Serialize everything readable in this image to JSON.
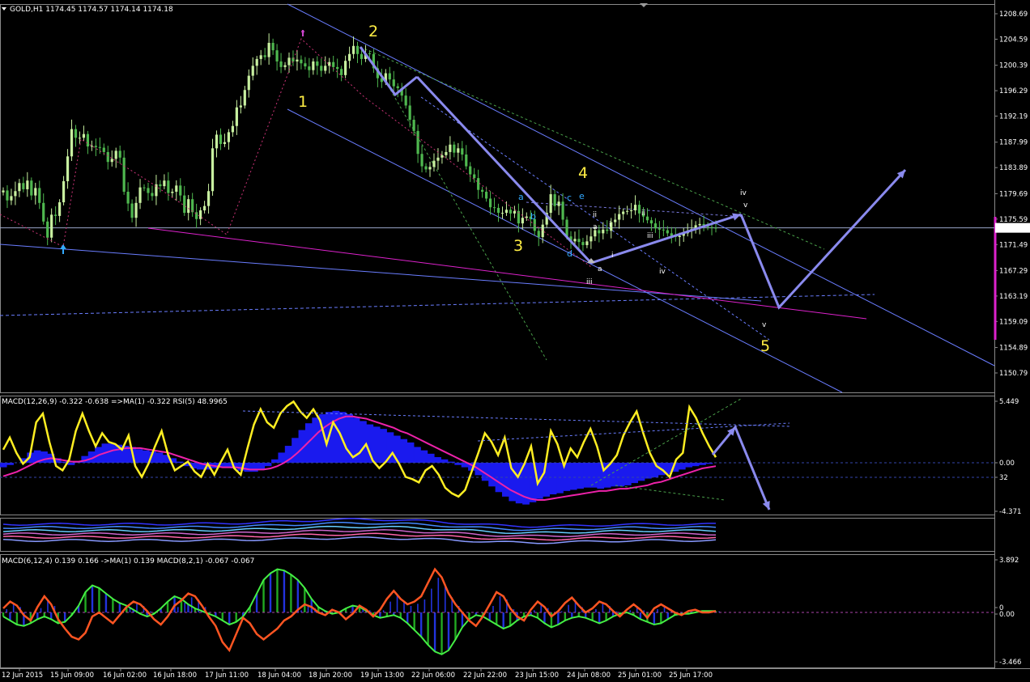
{
  "chart_data": {
    "type": "candlestick",
    "main": {
      "header": "GOLD,H1  1174.45 1174.57 1174.14 1174.18",
      "y_ticks": [
        "1208.69",
        "1204.59",
        "1200.39",
        "1196.29",
        "1192.19",
        "1187.99",
        "1183.89",
        "1179.69",
        "1175.59",
        "1171.49",
        "1167.29",
        "1163.19",
        "1159.09",
        "1154.89",
        "1150.79"
      ],
      "ylim": [
        1150.79,
        1208.69
      ],
      "current_price": "1174.18",
      "colors": {
        "bull": "#c8f0a0",
        "bear": "#4fb84f",
        "channel": "#6a7dff",
        "arrow": "#8a8aee",
        "support": "#dd22cc",
        "price_line": "#9aa6c8"
      },
      "closes": [
        1180.2,
        1178.6,
        1179.3,
        1180.1,
        1181.4,
        1180.4,
        1181.8,
        1179.4,
        1180.6,
        1178.2,
        1175.2,
        1172.6,
        1176.3,
        1176.1,
        1178.3,
        1181.7,
        1185.7,
        1190.1,
        1188.7,
        1188.7,
        1189.3,
        1187.3,
        1187.4,
        1187.2,
        1187.1,
        1186.4,
        1184.8,
        1185.3,
        1186.6,
        1185.5,
        1180.0,
        1178.1,
        1175.8,
        1178.2,
        1180.7,
        1180.6,
        1179.8,
        1179.3,
        1181.2,
        1180.9,
        1181.8,
        1179.8,
        1180.0,
        1181.0,
        1179.4,
        1176.6,
        1178.8,
        1176.7,
        1175.6,
        1177.0,
        1177.7,
        1180.1,
        1187.0,
        1189.2,
        1187.7,
        1188.0,
        1189.6,
        1190.6,
        1193.6,
        1193.9,
        1196.4,
        1198.7,
        1200.3,
        1201.4,
        1202.0,
        1201.7,
        1204.0,
        1202.8,
        1201.0,
        1200.1,
        1200.4,
        1201.6,
        1201.0,
        1201.3,
        1200.7,
        1200.2,
        1199.6,
        1201.0,
        1200.3,
        1199.5,
        1200.3,
        1200.9,
        1200.1,
        1199.8,
        1198.8,
        1201.1,
        1202.2,
        1203.5,
        1202.2,
        1201.4,
        1202.3,
        1202.2,
        1199.9,
        1198.3,
        1197.7,
        1199.1,
        1198.1,
        1197.0,
        1196.7,
        1195.5,
        1193.9,
        1191.6,
        1189.8,
        1186.1,
        1184.1,
        1183.6,
        1184.0,
        1185.0,
        1185.5,
        1185.9,
        1186.4,
        1187.6,
        1186.3,
        1187.0,
        1186.0,
        1184.1,
        1182.8,
        1182.2,
        1180.3,
        1180.0,
        1178.9,
        1177.5,
        1177.4,
        1176.6,
        1176.6,
        1177.1,
        1176.5,
        1176.9,
        1174.9,
        1175.8,
        1176.0,
        1175.6,
        1173.7,
        1172.7,
        1174.7,
        1176.6,
        1179.6,
        1177.7,
        1178.4,
        1175.5,
        1172.8,
        1172.0,
        1172.4,
        1171.9,
        1171.4,
        1172.0,
        1172.8,
        1173.8,
        1173.3,
        1173.9,
        1173.7,
        1175.1,
        1175.5,
        1176.4,
        1176.8,
        1176.9,
        1177.0,
        1177.9,
        1176.5,
        1176.0,
        1175.4,
        1174.9,
        1174.1,
        1173.9,
        1173.8,
        1173.3,
        1172.9,
        1172.7,
        1172.9,
        1173.3,
        1173.7,
        1174.0,
        1174.6,
        1174.8,
        1174.6,
        1174.3,
        1174.2,
        1174.18
      ],
      "wave_labels": [
        {
          "t": "1",
          "c": "#ffee44",
          "cls": "wave"
        },
        {
          "t": "2",
          "c": "#ffee44",
          "cls": "wave"
        },
        {
          "t": "3",
          "c": "#ffee44",
          "cls": "wave"
        },
        {
          "t": "4",
          "c": "#ffee44",
          "cls": "wave"
        },
        {
          "t": "5",
          "c": "#ffee44",
          "cls": "wave"
        },
        {
          "t": "a",
          "c": "#33aaff",
          "cls": "sub"
        },
        {
          "t": "b",
          "c": "#33aaff",
          "cls": "sub"
        },
        {
          "t": "c",
          "c": "#33aaff",
          "cls": "sub"
        },
        {
          "t": "d",
          "c": "#33aaff",
          "cls": "sub"
        },
        {
          "t": "e",
          "c": "#33aaff",
          "cls": "sub"
        },
        {
          "t": "iii",
          "c": "#cc44cc",
          "cls": "small"
        },
        {
          "t": "iv",
          "c": "#cc44cc",
          "cls": "small"
        },
        {
          "t": "v",
          "c": "#cc44cc",
          "cls": "small"
        },
        {
          "t": "ii",
          "c": "#cc4444",
          "cls": "small"
        },
        {
          "t": "a",
          "c": "#cc4444",
          "cls": "small"
        },
        {
          "t": "i",
          "c": "#cc4444",
          "cls": "small"
        },
        {
          "t": "a",
          "c": "#cc4444",
          "cls": "small"
        },
        {
          "t": "ii",
          "c": "#cc8844",
          "cls": "small"
        },
        {
          "t": "iii",
          "c": "#cc8844",
          "cls": "small"
        },
        {
          "t": "iv",
          "c": "#cc8844",
          "cls": "small"
        },
        {
          "t": "i",
          "c": "#cc8844",
          "cls": "small"
        },
        {
          "t": "v",
          "c": "#cc8844",
          "cls": "small"
        }
      ]
    },
    "panel1": {
      "header": "MACD(12,26,9) -0.322 -0.638  =>MA(1) -0.322  RSI(5) 48.9965",
      "y_ticks": [
        "5.449",
        "0.00",
        "32",
        "-4.371"
      ],
      "colors": {
        "histogram": "#1a1aee",
        "signal": "#ee22aa",
        "rsi": "#ffee22"
      },
      "macd": [
        -0.4,
        -0.2,
        0.0,
        0.4,
        0.9,
        1.1,
        1.0,
        0.8,
        0.4,
        0.1,
        -0.2,
        0.1,
        0.6,
        1.0,
        1.4,
        1.7,
        1.7,
        1.6,
        1.5,
        1.4,
        1.2,
        1.1,
        1.0,
        0.9,
        0.7,
        0.4,
        0.1,
        -0.3,
        -0.5,
        -0.6,
        -0.6,
        -0.5,
        -0.4,
        -0.4,
        -0.5,
        -0.7,
        -0.8,
        -0.8,
        -0.6,
        -0.3,
        0.3,
        0.9,
        1.5,
        2.2,
        2.9,
        3.5,
        4.0,
        4.3,
        4.5,
        4.6,
        4.5,
        4.3,
        4.0,
        3.7,
        3.4,
        3.2,
        3.0,
        2.7,
        2.4,
        2.1,
        1.8,
        1.4,
        1.1,
        0.8,
        0.5,
        0.3,
        0.1,
        -0.2,
        -0.4,
        -0.7,
        -1.1,
        -1.6,
        -2.1,
        -2.6,
        -3.0,
        -3.4,
        -3.6,
        -3.7,
        -3.5,
        -3.2,
        -3.0,
        -2.8,
        -2.7,
        -2.5,
        -2.4,
        -2.3,
        -2.2,
        -2.2,
        -2.3,
        -2.2,
        -2.1,
        -2.1,
        -2.0,
        -1.8,
        -1.6,
        -1.4,
        -1.3,
        -1.1,
        -1.0,
        -0.8,
        -0.6,
        -0.4,
        -0.3,
        -0.2,
        -0.1,
        0.0
      ],
      "rsi": [
        55,
        66,
        52,
        42,
        48,
        80,
        88,
        62,
        40,
        36,
        46,
        72,
        88,
        72,
        58,
        70,
        62,
        60,
        55,
        68,
        40,
        30,
        42,
        58,
        72,
        50,
        36,
        40,
        44,
        35,
        30,
        42,
        32,
        44,
        55,
        38,
        32,
        56,
        78,
        92,
        80,
        75,
        88,
        95,
        99,
        90,
        84,
        92,
        82,
        60,
        80,
        70,
        56,
        48,
        52,
        60,
        45,
        38,
        44,
        52,
        42,
        30,
        28,
        25,
        36,
        40,
        32,
        20,
        15,
        12,
        18,
        35,
        52,
        70,
        62,
        50,
        66,
        38,
        30,
        42,
        58,
        24,
        34,
        72,
        60,
        40,
        56,
        48,
        62,
        74,
        58,
        36,
        42,
        50,
        68,
        80,
        90,
        70,
        52,
        40,
        36,
        30,
        46,
        52,
        94,
        84,
        70,
        58,
        48
      ],
      "signal_line": [
        -1.2,
        -1.0,
        -0.8,
        -0.5,
        -0.2,
        0.1,
        0.3,
        0.4,
        0.3,
        0.2,
        0.1,
        0.1,
        0.2,
        0.4,
        0.7,
        0.9,
        1.1,
        1.2,
        1.3,
        1.3,
        1.3,
        1.2,
        1.1,
        1.0,
        0.9,
        0.7,
        0.5,
        0.3,
        0.1,
        -0.1,
        -0.2,
        -0.3,
        -0.4,
        -0.4,
        -0.4,
        -0.5,
        -0.6,
        -0.6,
        -0.6,
        -0.5,
        -0.3,
        0.0,
        0.4,
        0.9,
        1.5,
        2.1,
        2.7,
        3.2,
        3.6,
        3.9,
        4.1,
        4.1,
        4.0,
        3.9,
        3.7,
        3.5,
        3.3,
        3.1,
        2.8,
        2.6,
        2.3,
        2.0,
        1.7,
        1.4,
        1.1,
        0.8,
        0.5,
        0.2,
        -0.1,
        -0.4,
        -0.8,
        -1.2,
        -1.6,
        -2.0,
        -2.4,
        -2.7,
        -3.0,
        -3.2,
        -3.3,
        -3.3,
        -3.2,
        -3.1,
        -3.0,
        -2.9,
        -2.8,
        -2.7,
        -2.6,
        -2.5,
        -2.5,
        -2.4,
        -2.3,
        -2.3,
        -2.2,
        -2.1,
        -2.0,
        -1.8,
        -1.7,
        -1.5,
        -1.3,
        -1.1,
        -0.9,
        -0.7,
        -0.5,
        -0.4,
        -0.3
      ]
    },
    "panel2": {
      "colors": [
        "#3333ff",
        "#4488ff",
        "#66ccff",
        "#cc66cc",
        "#ff66aa",
        "#8899ff"
      ]
    },
    "panel3": {
      "header": "MACD(6,12,4) 0.139 0.166  ->MA(1) 0.139  MACD(8,2,1) -0.067 -0.067",
      "y_ticks": [
        "3.892",
        "0",
        "0.00",
        "-3.466"
      ],
      "colors": {
        "green_hist": "#22aa22",
        "blue_hist": "#2233dd",
        "green_line": "#44ee44",
        "red_line": "#ff5522"
      },
      "green_line": [
        -0.3,
        -0.6,
        -0.9,
        -1.0,
        -0.8,
        -0.5,
        -0.3,
        -0.5,
        -0.8,
        -0.7,
        -0.2,
        0.5,
        1.5,
        2.0,
        1.8,
        1.4,
        1.0,
        0.7,
        0.5,
        0.2,
        -0.1,
        -0.3,
        -0.1,
        0.3,
        0.8,
        1.2,
        1.0,
        0.6,
        0.3,
        0.1,
        -0.1,
        -0.3,
        -0.6,
        -0.9,
        -0.7,
        -0.3,
        0.4,
        1.4,
        2.4,
        2.9,
        3.2,
        3.1,
        2.8,
        2.4,
        1.8,
        1.0,
        0.4,
        0.1,
        -0.1,
        0.0,
        0.3,
        0.5,
        0.4,
        0.1,
        -0.2,
        -0.4,
        -0.3,
        -0.2,
        -0.4,
        -0.8,
        -1.3,
        -1.8,
        -2.4,
        -2.9,
        -3.1,
        -2.8,
        -2.0,
        -1.1,
        -0.5,
        -0.2,
        -0.3,
        -0.6,
        -0.9,
        -1.2,
        -1.0,
        -0.6,
        -0.3,
        -0.2,
        -0.4,
        -0.8,
        -1.1,
        -0.9,
        -0.6,
        -0.4,
        -0.3,
        -0.4,
        -0.6,
        -0.8,
        -0.6,
        -0.3,
        -0.1,
        0.0,
        -0.2,
        -0.5,
        -0.7,
        -0.9,
        -0.8,
        -0.5,
        -0.2,
        -0.1,
        -0.1,
        0.0,
        0.1,
        0.1,
        0.1
      ],
      "red_line": [
        0.3,
        0.8,
        0.5,
        -0.2,
        -0.6,
        0.4,
        1.2,
        0.6,
        -0.5,
        -1.2,
        -1.8,
        -2.0,
        -1.5,
        -0.3,
        0.0,
        -0.4,
        -0.8,
        -0.2,
        0.4,
        0.8,
        0.6,
        0.1,
        -0.5,
        -0.9,
        -0.3,
        0.5,
        0.9,
        1.4,
        1.2,
        0.5,
        -0.3,
        -1.0,
        -2.2,
        -2.8,
        -1.6,
        -0.4,
        -0.8,
        -1.6,
        -2.0,
        -1.6,
        -1.2,
        -0.6,
        -0.3,
        0.2,
        0.6,
        0.4,
        0.0,
        -0.2,
        0.2,
        0.0,
        -0.5,
        -0.1,
        0.5,
        0.2,
        -0.3,
        0.2,
        1.0,
        1.6,
        1.0,
        0.6,
        0.8,
        1.2,
        2.2,
        3.2,
        2.6,
        1.4,
        0.6,
        0.0,
        -0.6,
        -1.0,
        -0.3,
        0.6,
        1.5,
        1.2,
        0.3,
        -0.3,
        -0.6,
        0.2,
        0.8,
        0.4,
        -0.3,
        0.1,
        0.7,
        1.1,
        0.5,
        0.0,
        0.3,
        0.8,
        0.6,
        0.1,
        -0.3,
        0.2,
        0.6,
        0.2,
        -0.4,
        0.3,
        0.6,
        0.3,
        0.0,
        -0.2,
        0.1,
        0.2,
        0.0,
        0.0,
        0.1
      ]
    },
    "x_ticks": [
      "12 Jun 2015",
      "15 Jun 09:00",
      "16 Jun 02:00",
      "16 Jun 18:00",
      "17 Jun 11:00",
      "18 Jun 04:00",
      "18 Jun 20:00",
      "19 Jun 13:00",
      "22 Jun 06:00",
      "22 Jun 22:00",
      "23 Jun 15:00",
      "24 Jun 08:00",
      "25 Jun 01:00",
      "25 Jun 17:00"
    ]
  }
}
